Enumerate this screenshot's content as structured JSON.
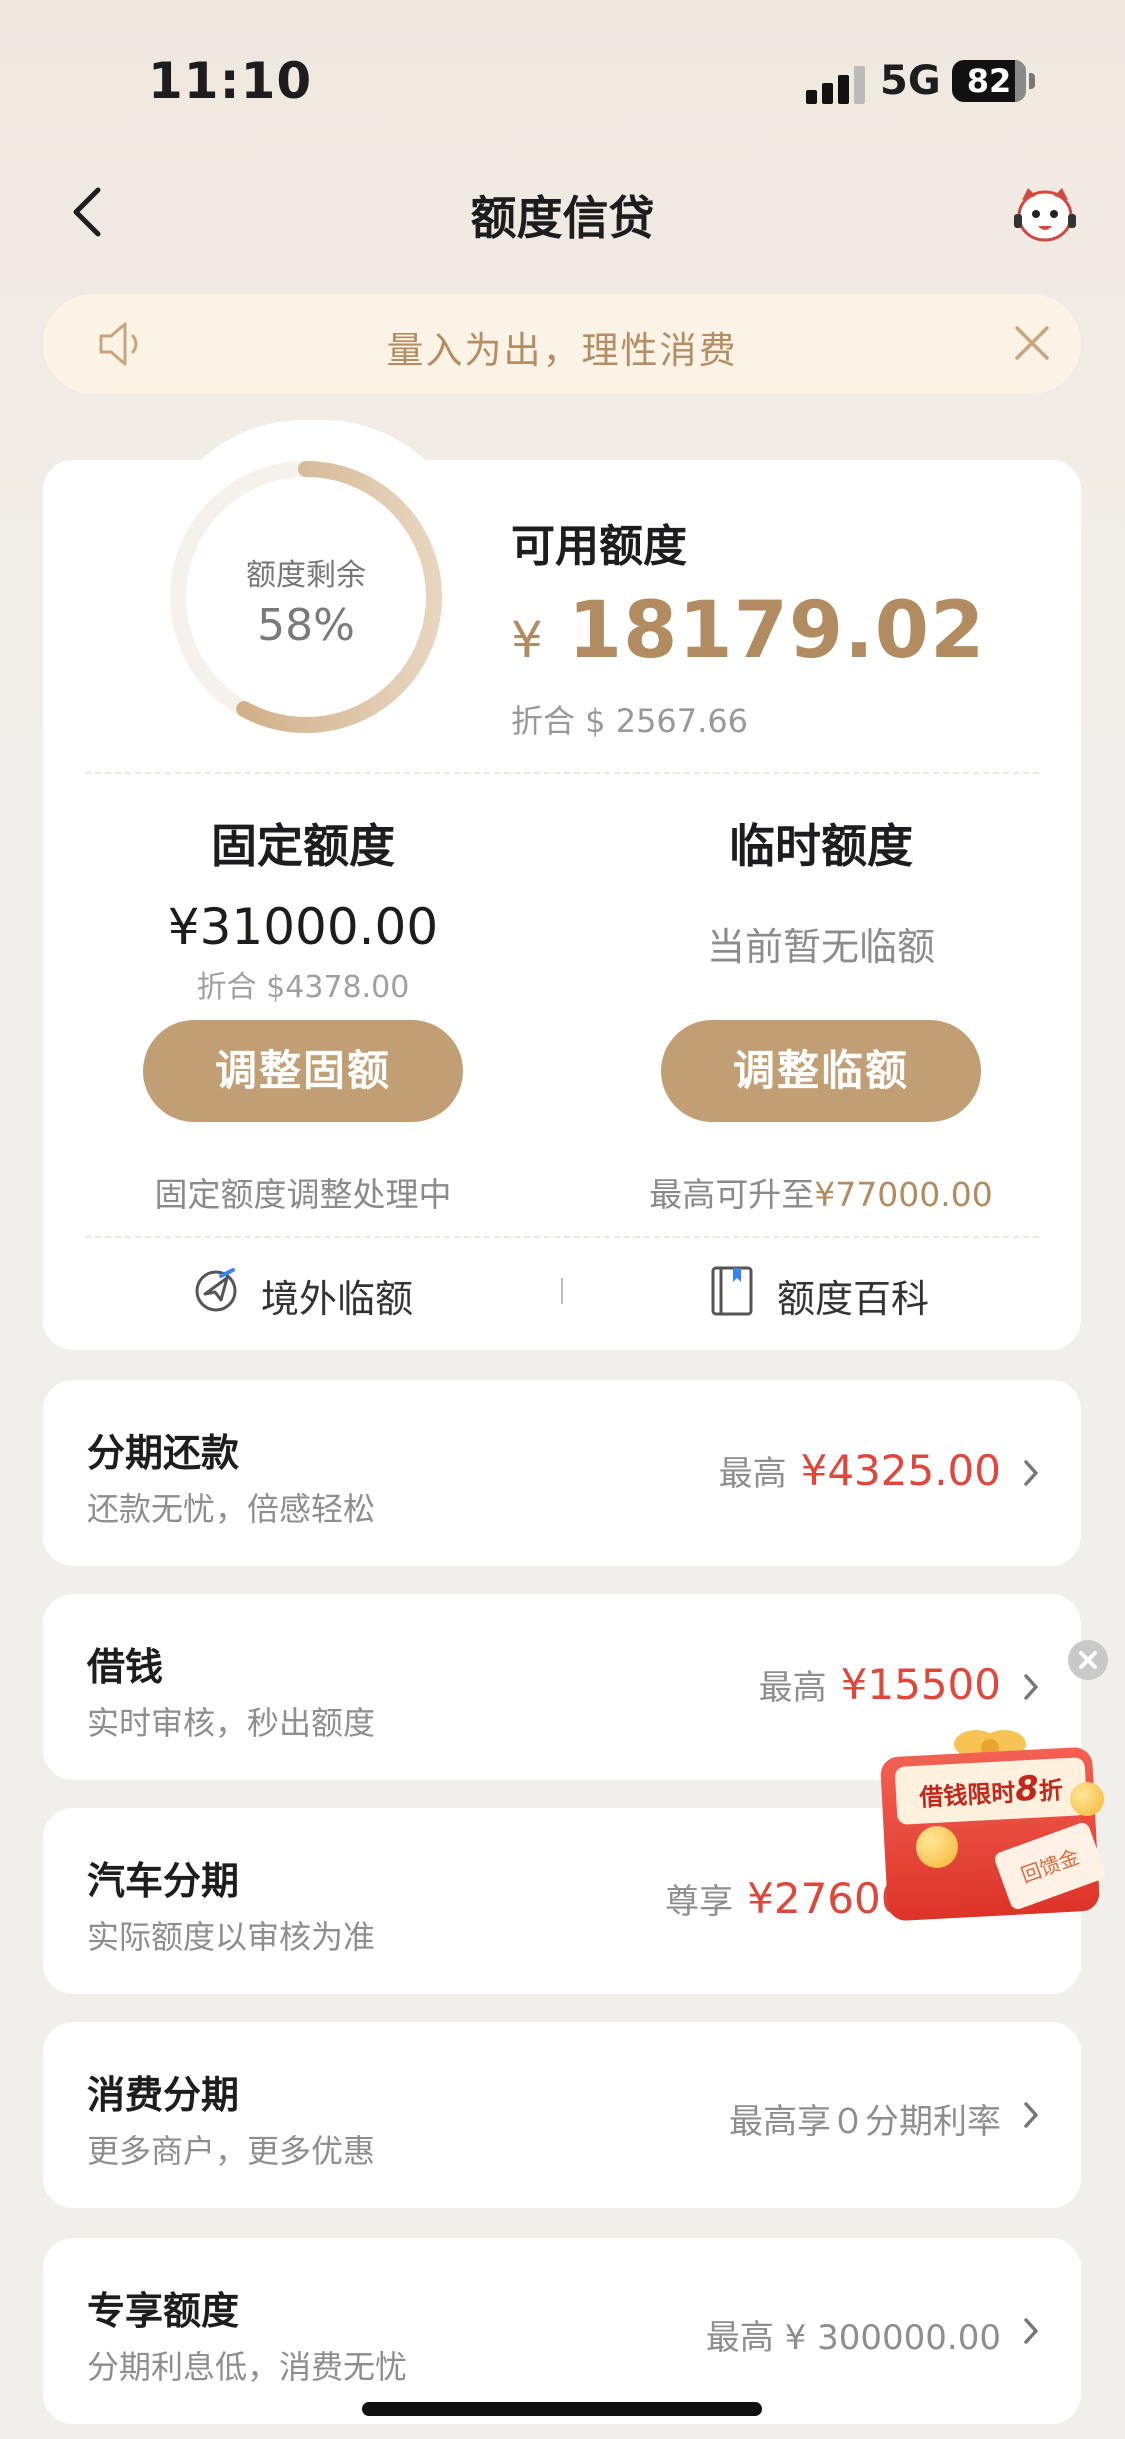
{
  "status_bar": {
    "time": "11:10",
    "network": "5G",
    "battery": "82"
  },
  "nav": {
    "title": "额度信贷"
  },
  "notice": {
    "text": "量入为出，理性消费"
  },
  "credit": {
    "ring_label": "额度剩余",
    "ring_percent": "58%",
    "remaining_fraction": 0.58,
    "available_label": "可用额度",
    "available_currency": "¥",
    "available_amount": "18179.02",
    "available_usd": "折合 $ 2567.66",
    "fixed": {
      "title": "固定额度",
      "amount": "¥31000.00",
      "usd": "折合 $4378.00",
      "button": "调整固额",
      "note": "固定额度调整处理中"
    },
    "temporary": {
      "title": "临时额度",
      "status": "当前暂无临额",
      "button": "调整临额",
      "note_prefix": "最高可升至",
      "note_amount": "¥77000.00"
    },
    "links": {
      "overseas": "境外临额",
      "encyclopedia": "额度百科"
    }
  },
  "rows": [
    {
      "title": "分期还款",
      "subtitle": "还款无忧，倍感轻松",
      "prefix": "最高",
      "amount": "¥4325.00"
    },
    {
      "title": "借钱",
      "subtitle": "实时审核，秒出额度",
      "prefix": "最高",
      "amount": "¥15500"
    },
    {
      "title": "汽车分期",
      "subtitle": "实际额度以审核为准",
      "prefix": "尊享",
      "amount": "¥276000.00"
    },
    {
      "title": "消费分期",
      "subtitle": "更多商户，更多优惠",
      "prefix": "最高享０分期利率"
    },
    {
      "title": "专享额度",
      "subtitle": "分期利息低，消费无忧",
      "prefix": "最高 ¥ 300000.00"
    }
  ],
  "promo": {
    "text_prefix": "借钱限时",
    "text_big": "8",
    "text_suffix": "折",
    "tag": "回馈金"
  },
  "colors": {
    "accent": "#c29e75",
    "gold_text": "#b28c60",
    "red": "#e0463a"
  }
}
